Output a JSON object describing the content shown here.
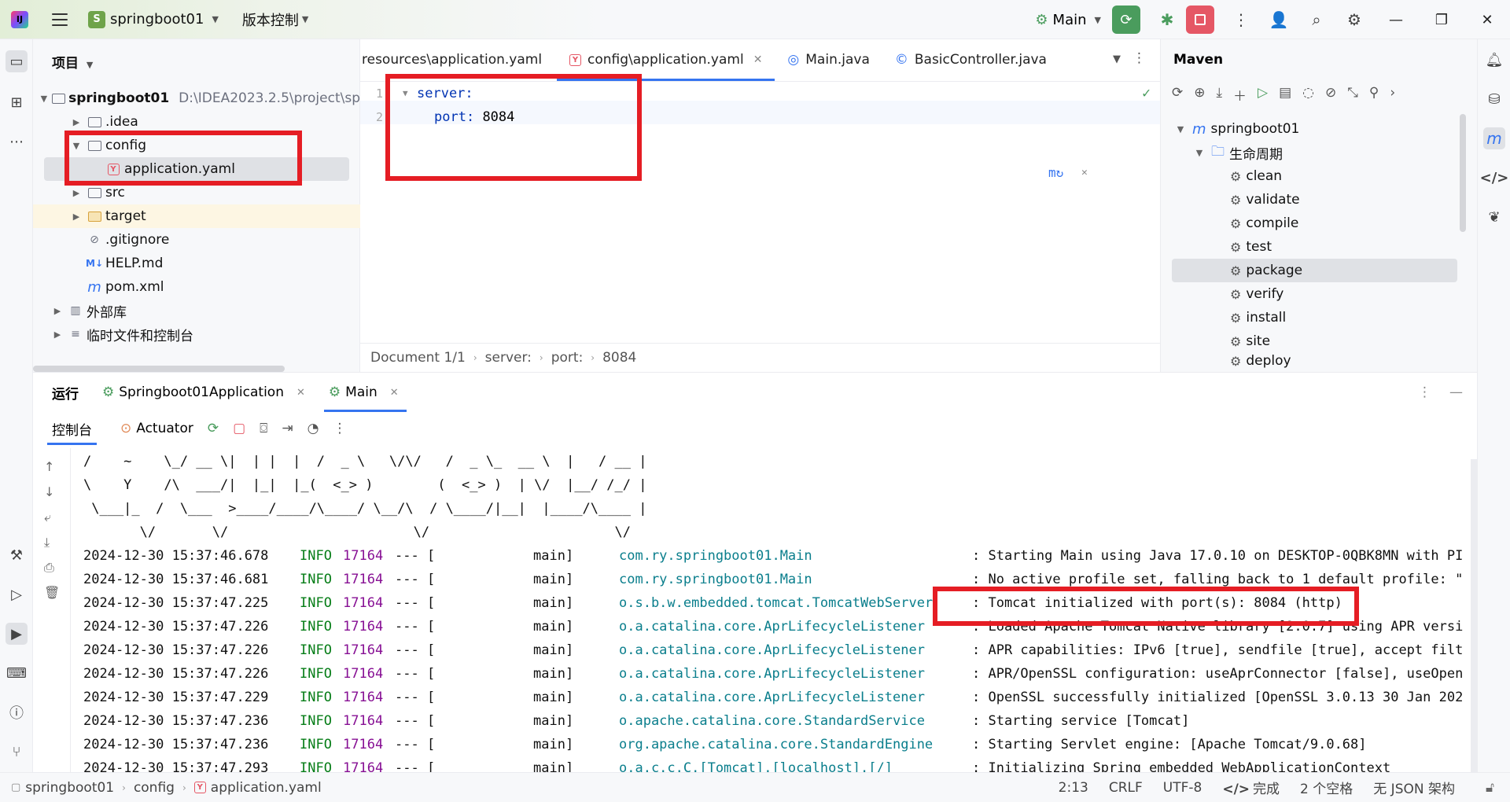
{
  "titlebar": {
    "project_badge": "S",
    "project_name": "springboot01",
    "vcs_label": "版本控制",
    "run_config": "Main"
  },
  "project_panel": {
    "title": "项目",
    "root_name": "springboot01",
    "root_path": "D:\\IDEA2023.2.5\\project\\sp",
    "items": [
      {
        "label": ".idea"
      },
      {
        "label": "config"
      },
      {
        "label": "application.yaml"
      },
      {
        "label": "src"
      },
      {
        "label": "target"
      },
      {
        "label": ".gitignore"
      },
      {
        "label": "HELP.md"
      },
      {
        "label": "pom.xml"
      },
      {
        "label": "外部库"
      },
      {
        "label": "临时文件和控制台"
      }
    ]
  },
  "editor": {
    "tabs": [
      {
        "label": "resources\\application.yaml"
      },
      {
        "label": "config\\application.yaml"
      },
      {
        "label": "Main.java"
      },
      {
        "label": "BasicController.java"
      }
    ],
    "code": {
      "line1_key": "server:",
      "line2_key": "port:",
      "line2_value": "8084"
    },
    "breadcrumb": [
      "Document 1/1",
      "server:",
      "port:",
      "8084"
    ]
  },
  "maven": {
    "title": "Maven",
    "root": "springboot01",
    "lifecycle": "生命周期",
    "goals": [
      "clean",
      "validate",
      "compile",
      "test",
      "package",
      "verify",
      "install",
      "site",
      "deploy"
    ]
  },
  "run_panel": {
    "title": "运行",
    "tabs": [
      {
        "label": "Springboot01Application"
      },
      {
        "label": "Main"
      }
    ],
    "sub_tabs": [
      {
        "label": "控制台"
      },
      {
        "label": "Actuator"
      }
    ],
    "banner": [
      "/    ~    \\_/ __ \\|  | |  |  /  _ \\   \\/\\/   /  _ \\_  __ \\  |   / __ |",
      "\\    Y    /\\  ___/|  |_|  |_(  <_> )        (  <_> )  | \\/  |__/ /_/ |",
      " \\___|_  /  \\___  >____/____/\\____/ \\__/\\  / \\____/|__|  |____/\\____ |",
      "       \\/       \\/                       \\/                       \\/"
    ],
    "logs": [
      {
        "ts": "2024-12-30 15:37:46.678",
        "level": "INFO",
        "pid": "17164",
        "sep": "--- [",
        "thread": "main]",
        "logger": "com.ry.springboot01.Main",
        "msg": ": Starting Main using Java 17.0.10 on DESKTOP-0QBK8MN with PI"
      },
      {
        "ts": "2024-12-30 15:37:46.681",
        "level": "INFO",
        "pid": "17164",
        "sep": "--- [",
        "thread": "main]",
        "logger": "com.ry.springboot01.Main",
        "msg": ": No active profile set, falling back to 1 default profile: \""
      },
      {
        "ts": "2024-12-30 15:37:47.225",
        "level": "INFO",
        "pid": "17164",
        "sep": "--- [",
        "thread": "main]",
        "logger": "o.s.b.w.embedded.tomcat.TomcatWebServer",
        "msg": ": Tomcat initialized with port(s): 8084 (http)"
      },
      {
        "ts": "2024-12-30 15:37:47.226",
        "level": "INFO",
        "pid": "17164",
        "sep": "--- [",
        "thread": "main]",
        "logger": "o.a.catalina.core.AprLifecycleListener",
        "msg": ": Loaded Apache Tomcat Native library [2.0.7] using APR versi"
      },
      {
        "ts": "2024-12-30 15:37:47.226",
        "level": "INFO",
        "pid": "17164",
        "sep": "--- [",
        "thread": "main]",
        "logger": "o.a.catalina.core.AprLifecycleListener",
        "msg": ": APR capabilities: IPv6 [true], sendfile [true], accept filt"
      },
      {
        "ts": "2024-12-30 15:37:47.226",
        "level": "INFO",
        "pid": "17164",
        "sep": "--- [",
        "thread": "main]",
        "logger": "o.a.catalina.core.AprLifecycleListener",
        "msg": ": APR/OpenSSL configuration: useAprConnector [false], useOpen"
      },
      {
        "ts": "2024-12-30 15:37:47.229",
        "level": "INFO",
        "pid": "17164",
        "sep": "--- [",
        "thread": "main]",
        "logger": "o.a.catalina.core.AprLifecycleListener",
        "msg": ": OpenSSL successfully initialized [OpenSSL 3.0.13 30 Jan 202"
      },
      {
        "ts": "2024-12-30 15:37:47.236",
        "level": "INFO",
        "pid": "17164",
        "sep": "--- [",
        "thread": "main]",
        "logger": "o.apache.catalina.core.StandardService",
        "msg": ": Starting service [Tomcat]"
      },
      {
        "ts": "2024-12-30 15:37:47.236",
        "level": "INFO",
        "pid": "17164",
        "sep": "--- [",
        "thread": "main]",
        "logger": "org.apache.catalina.core.StandardEngine",
        "msg": ": Starting Servlet engine: [Apache Tomcat/9.0.68]"
      },
      {
        "ts": "2024-12-30 15:37:47.293",
        "level": "INFO",
        "pid": "17164",
        "sep": "--- [",
        "thread": "main]",
        "logger": "o.a.c.c.C.[Tomcat].[localhost].[/]",
        "msg": ": Initializing Spring embedded WebApplicationContext"
      }
    ]
  },
  "statusbar": {
    "crumbs": [
      "springboot01",
      "config",
      "application.yaml"
    ],
    "position": "2:13",
    "line_sep": "CRLF",
    "encoding": "UTF-8",
    "status": "完成",
    "indent": "2 个空格",
    "schema": "无 JSON 架构"
  },
  "colors": {
    "accent": "#3574f0",
    "annotation_red": "#e51d24",
    "run_green": "#4a9c5d",
    "stop_red": "#e55765"
  }
}
